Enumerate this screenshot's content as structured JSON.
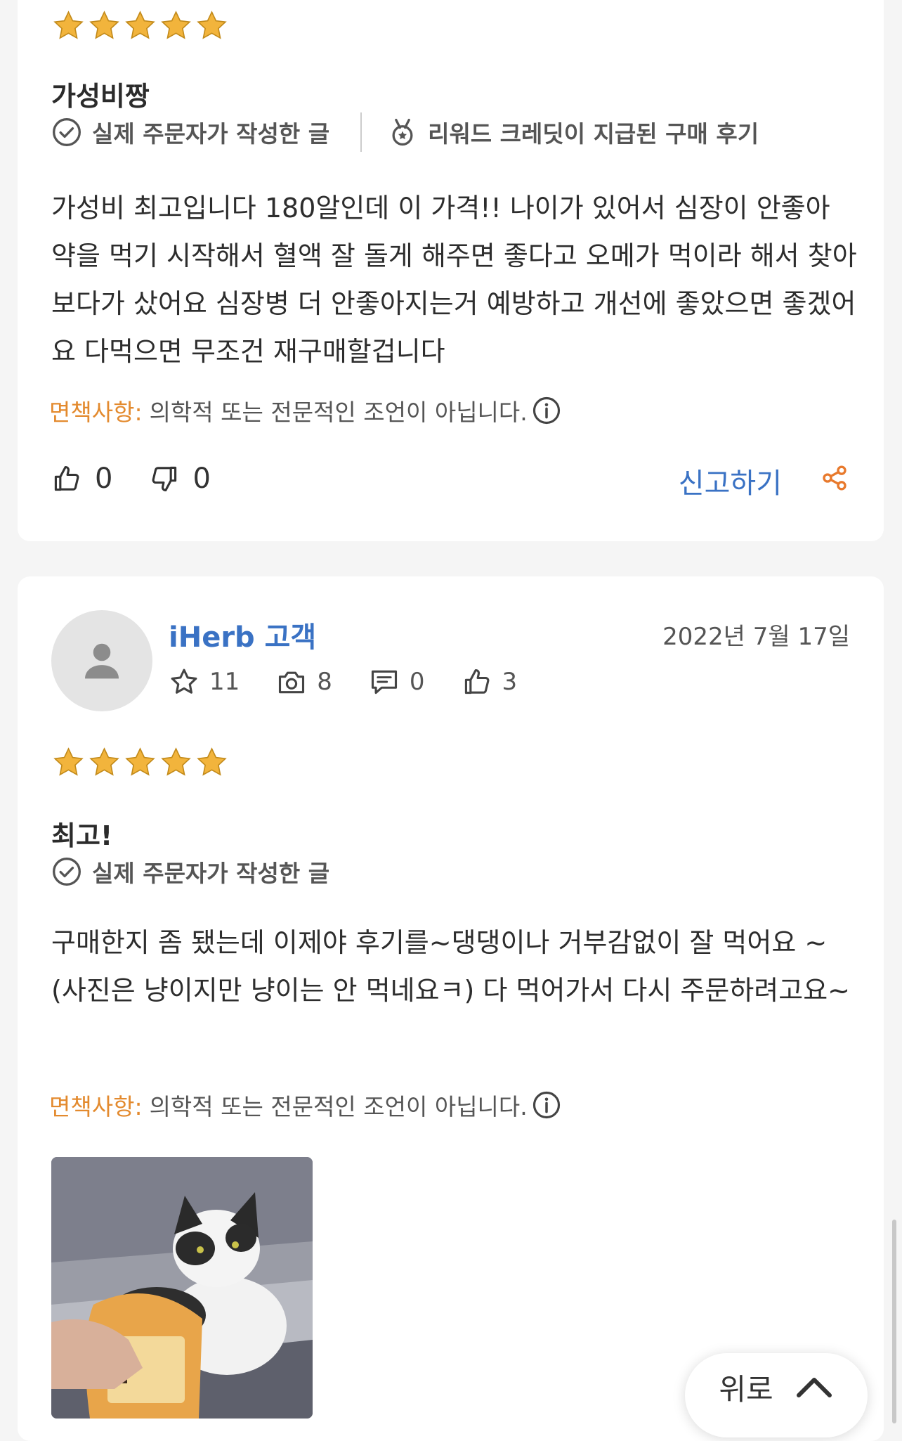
{
  "review1": {
    "rating": 5,
    "title": "가성비짱",
    "badges": {
      "verified_purchase": "실제 주문자가 작성한 글",
      "rewarded": "리워드 크레딧이 지급된 구매 후기"
    },
    "body": "가성비 최고입니다 180알인데 이 가격!! 나이가 있어서 심장이 안좋아 약을 먹기 시작해서 혈액 잘 돌게 해주면 좋다고 오메가 먹이라 해서 찾아보다가 샀어요 심장병 더 안좋아지는거 예방하고 개선에 좋았으면 좋겠어요 다먹으면 무조건 재구매할겁니다",
    "disclaimer_label": "면책사항:",
    "disclaimer_text": "의학적 또는 전문적인 조언이 아닙니다.",
    "helpful_count": "0",
    "unhelpful_count": "0",
    "report_label": "신고하기"
  },
  "review2": {
    "username": "iHerb 고객",
    "date": "2022년 7월 17일",
    "stats": {
      "ratings": "11",
      "photos": "8",
      "comments": "0",
      "likes": "3"
    },
    "rating": 5,
    "title": "최고!",
    "badges": {
      "verified_purchase": "실제 주문자가 작성한 글"
    },
    "body": "구매한지 좀 됐는데 이제야 후기를~댕댕이나 거부감없이 잘 먹어요 ~(사진은 냥이지만 냥이는 안 먹네요ㅋ) 다 먹어가서 다시 주문하려고요~",
    "disclaimer_label": "면책사항:",
    "disclaimer_text": "의학적 또는 전문적인 조언이 아닙니다.",
    "photo_alt": "cat-with-product-photo"
  },
  "scroll_top_label": "위로",
  "colors": {
    "star": "#f2b43c",
    "accent_blue": "#3a72c4",
    "disclaimer_orange": "#e38a2e",
    "share_orange": "#e8792c"
  }
}
